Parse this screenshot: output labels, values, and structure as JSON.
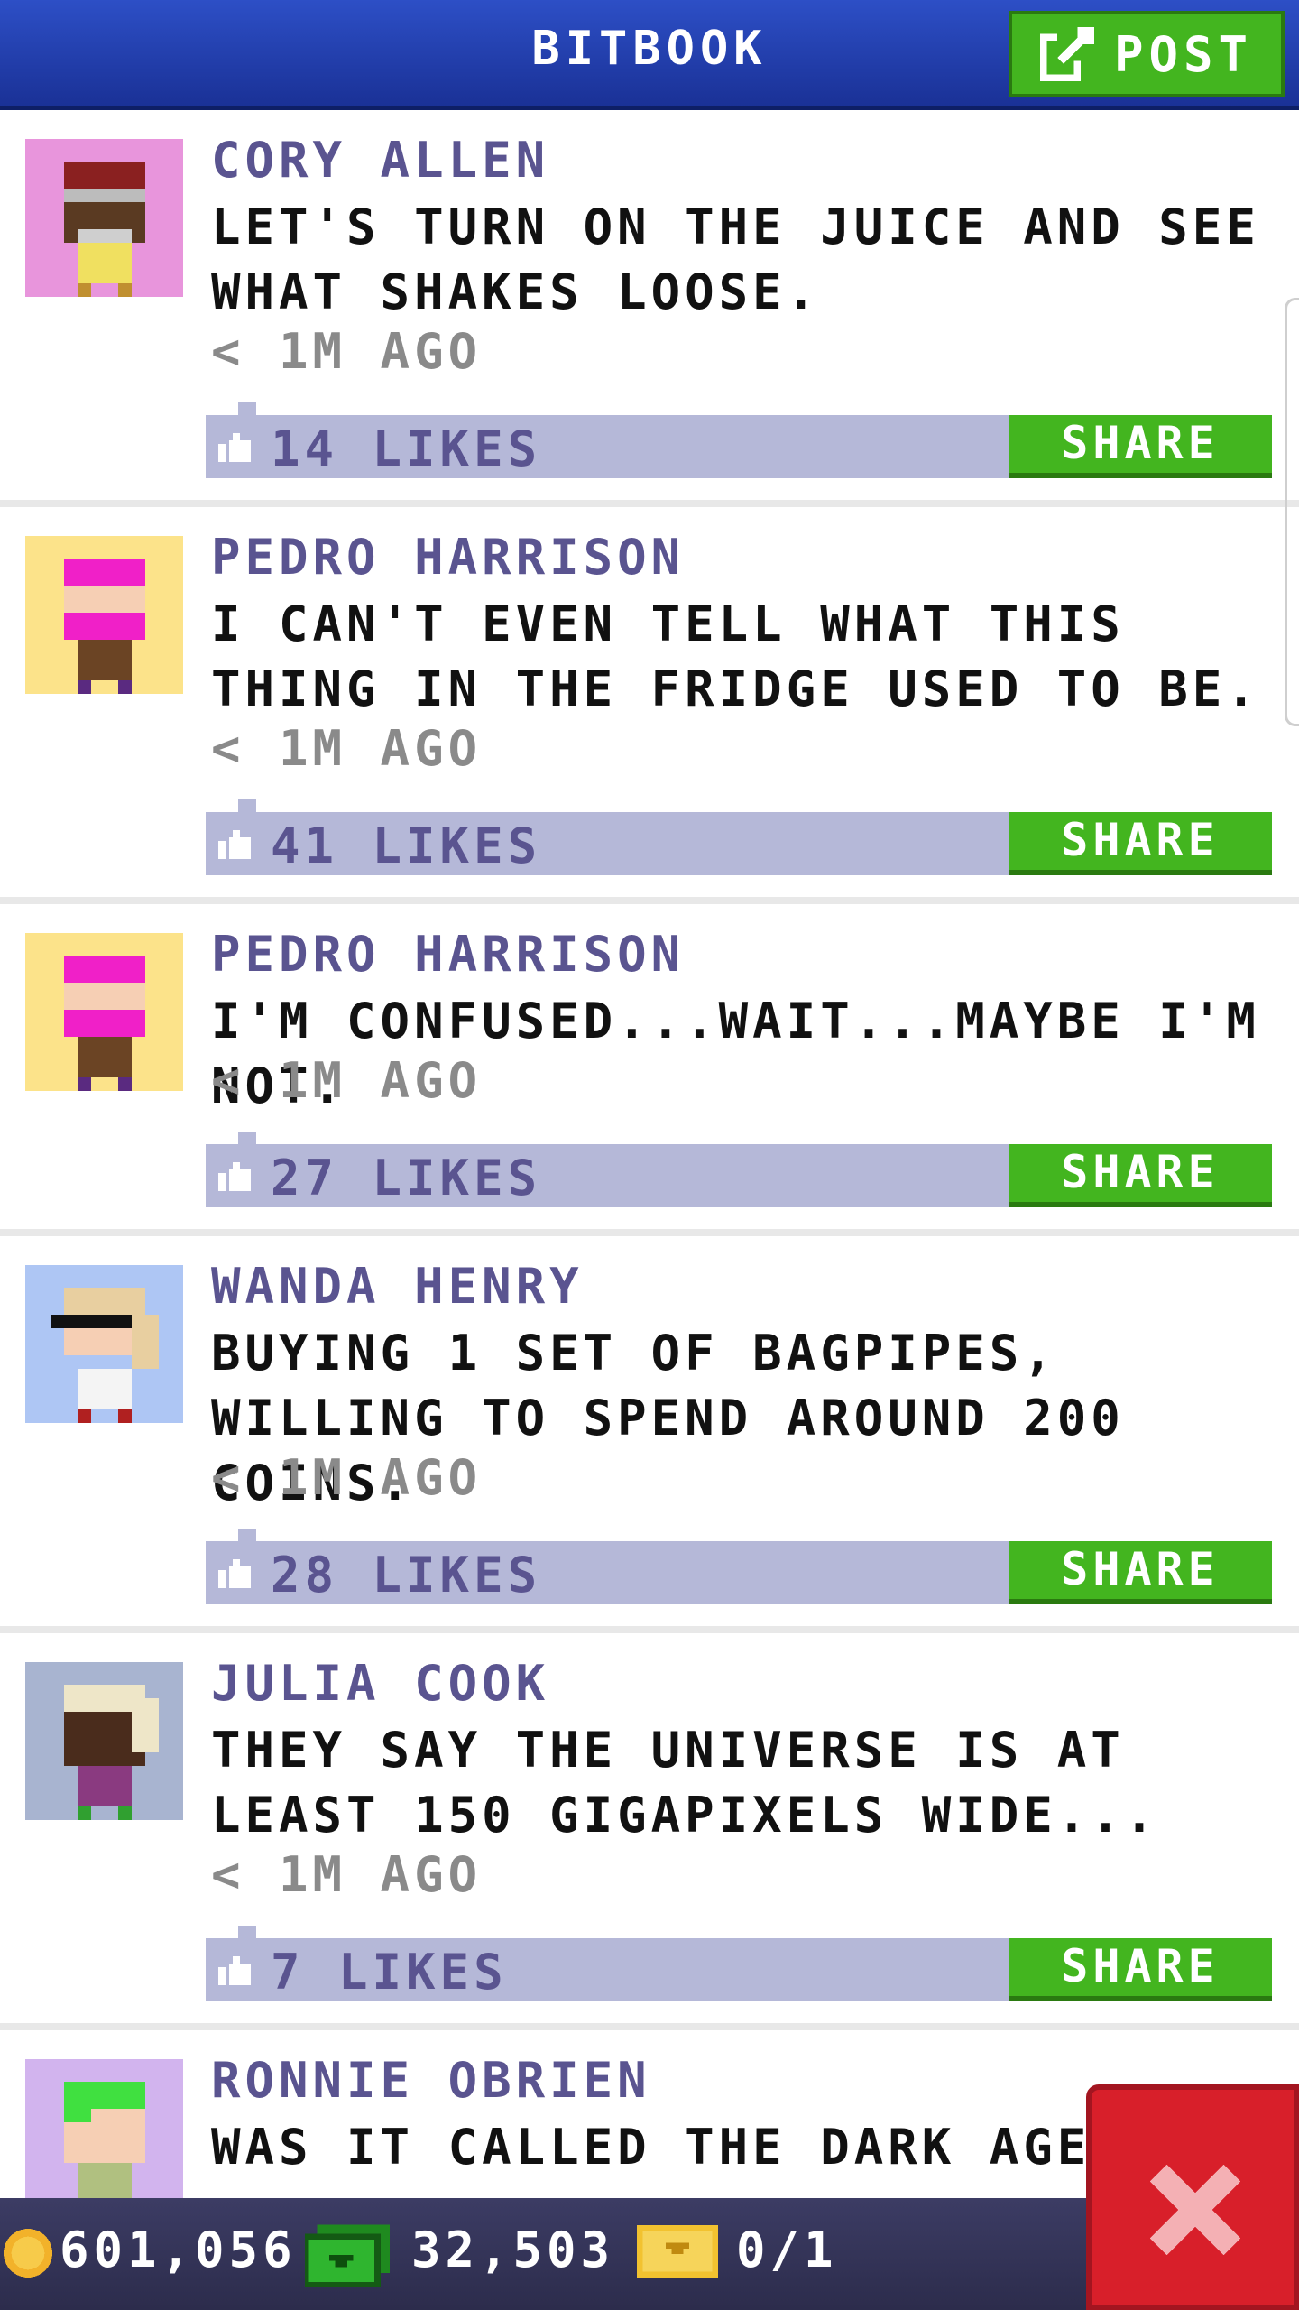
{
  "app": {
    "title": "BITBOOK",
    "post_label": "POST"
  },
  "posts": [
    {
      "author": "CORY ALLEN",
      "message": "LET'S TURN ON THE JUICE AND SEE WHAT SHAKES LOOSE.",
      "time": "< 1M AGO",
      "likes": "14 LIKES",
      "share": "SHARE",
      "avatar_bg": "#e895dc",
      "avatar_icon": "avatar-cory"
    },
    {
      "author": "PEDRO HARRISON",
      "message": "I CAN'T EVEN TELL WHAT THIS THING IN THE FRIDGE USED TO BE.",
      "time": "< 1M AGO",
      "likes": "41 LIKES",
      "share": "SHARE",
      "avatar_bg": "#fce38a",
      "avatar_icon": "avatar-pedro"
    },
    {
      "author": "PEDRO HARRISON",
      "message": "I'M CONFUSED...WAIT...MAYBE I'M NOT.",
      "time": "< 1M AGO",
      "likes": "27 LIKES",
      "share": "SHARE",
      "avatar_bg": "#fce38a",
      "avatar_icon": "avatar-pedro"
    },
    {
      "author": "WANDA HENRY",
      "message": "BUYING 1 SET OF BAGPIPES, WILLING TO SPEND AROUND 200 COINS.",
      "time": "< 1M AGO",
      "likes": "28 LIKES",
      "share": "SHARE",
      "avatar_bg": "#aec6f4",
      "avatar_icon": "avatar-wanda"
    },
    {
      "author": "JULIA COOK",
      "message": "THEY SAY THE UNIVERSE IS AT LEAST 150 GIGAPIXELS WIDE...",
      "time": "< 1M AGO",
      "likes": "7 LIKES",
      "share": "SHARE",
      "avatar_bg": "#a8b4d0",
      "avatar_icon": "avatar-julia"
    },
    {
      "author": "RONNIE OBRIEN",
      "message": "WAS IT CALLED THE DARK AGES",
      "time": "",
      "likes": "",
      "share": "",
      "avatar_bg": "#d2b4ee",
      "avatar_icon": "avatar-ronnie"
    }
  ],
  "status": {
    "coins": "601,056",
    "bux": "32,503",
    "tickets": "0/1"
  },
  "colors": {
    "header_blue": "#1a3196",
    "accent_green": "#43b51f",
    "like_bar": "#b5b8d8",
    "author_purple": "#5a5490",
    "close_red": "#d81f2a"
  }
}
